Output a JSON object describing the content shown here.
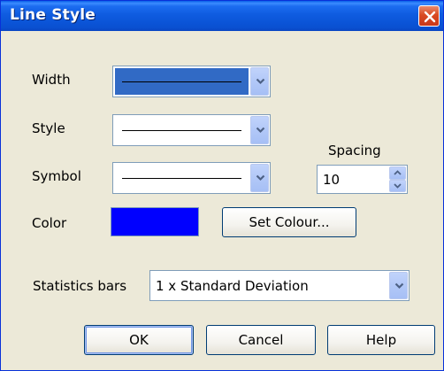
{
  "window": {
    "title": "Line Style"
  },
  "colors": {
    "selected_color": "#0000ff",
    "titlebar": "#0a5fe8",
    "close_button": "#d94a22"
  },
  "form": {
    "width_label": "Width",
    "style_label": "Style",
    "symbol_label": "Symbol",
    "color_label": "Color",
    "spacing_label": "Spacing",
    "spacing_value": "10",
    "set_colour_label": "Set Colour...",
    "statistics_label": "Statistics bars",
    "statistics_value": "1 x Standard Deviation"
  },
  "buttons": {
    "ok": "OK",
    "cancel": "Cancel",
    "help": "Help"
  },
  "icons": {
    "close": "close-icon",
    "dropdown": "chevron-down-icon",
    "spin_up": "arrow-up-icon",
    "spin_down": "arrow-down-icon"
  }
}
